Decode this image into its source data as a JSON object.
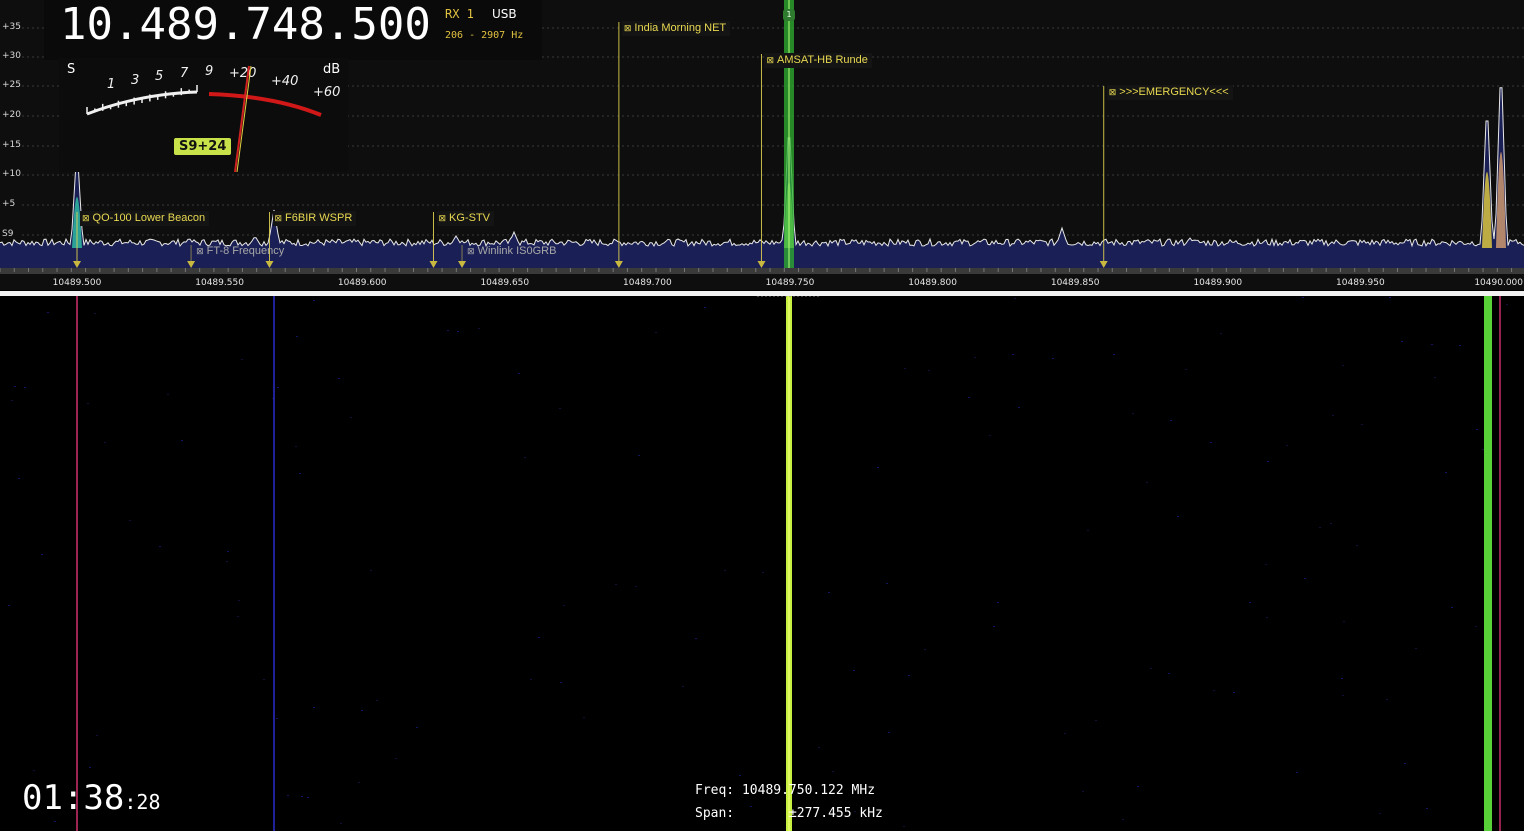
{
  "vfo": {
    "frequency": "10.489.748.500",
    "rx": "RX 1",
    "mode": "USB",
    "bandwidth": "206 - 2907 Hz",
    "rx_marker": "1"
  },
  "smeter": {
    "s_label": "S",
    "db_label": "dB",
    "s_scale": [
      "1",
      "3",
      "5",
      "7",
      "9"
    ],
    "db_scale": [
      "+20",
      "+40",
      "+60"
    ],
    "reading": "S9+24",
    "level_fraction": 0.72
  },
  "db_axis": [
    "+35",
    "+30",
    "+25",
    "+20",
    "+15",
    "+10",
    "+5",
    "S9"
  ],
  "freq_axis": [
    "10489.500",
    "10489.550",
    "10489.600",
    "10489.650",
    "10489.700",
    "10489.750",
    "10489.800",
    "10489.850",
    "10489.900",
    "10489.950",
    "10490.000"
  ],
  "bookmarks": [
    {
      "label": "QO-100 Lower Beacon",
      "freq": 10489.5,
      "row": "low",
      "dim": false
    },
    {
      "label": "FT-8 Frequency",
      "freq": 10489.54,
      "row": "bottom",
      "dim": true
    },
    {
      "label": "F6BIR WSPR",
      "freq": 10489.5675,
      "row": "low",
      "dim": false
    },
    {
      "label": "KG-STV",
      "freq": 10489.625,
      "row": "low",
      "dim": false
    },
    {
      "label": "Winlink IS0GRB",
      "freq": 10489.635,
      "row": "bottom",
      "dim": true
    },
    {
      "label": "India Morning NET",
      "freq": 10489.69,
      "row": "top",
      "dim": false
    },
    {
      "label": "AMSAT-HB Runde",
      "freq": 10489.74,
      "row": "mid",
      "dim": false
    },
    {
      "label": ">>>EMERGENCY<<<",
      "freq": 10489.86,
      "row": "mid2",
      "dim": false
    }
  ],
  "status": {
    "clock_hm": "01:38",
    "clock_s": ":28",
    "freq_label": "Freq:",
    "freq_value": "10489.750.122 MHz",
    "span_label": "Span:",
    "span_value": "±277.455 kHz"
  },
  "colors": {
    "bookmark": "#e8d850",
    "rx_passband": "#2fb12f",
    "spectrum_fill": "#1a1f55",
    "smeter_red": "#d01818",
    "badge": "#c8e24a"
  }
}
